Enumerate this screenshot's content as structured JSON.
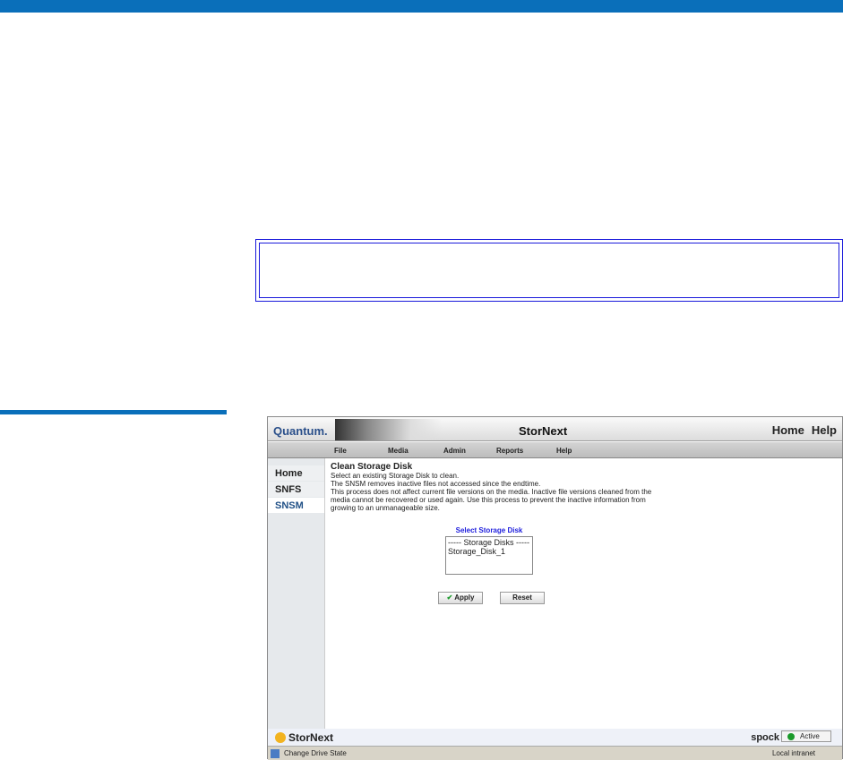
{
  "app": {
    "logo": "Quantum.",
    "title": "StorNext",
    "header_links": [
      "Home",
      "Help"
    ]
  },
  "menu": [
    "File",
    "Media",
    "Admin",
    "Reports",
    "Help"
  ],
  "sidebar": [
    "Home",
    "SNFS",
    "SNSM"
  ],
  "content": {
    "title": "Clean Storage Disk",
    "lines": [
      "Select an existing Storage Disk to clean.",
      "The SNSM removes inactive files not accessed since the endtime.",
      "This process does not affect current file versions on the media. Inactive file versions cleaned from the",
      "media cannot be recovered or used again. Use this process to prevent the inactive information from",
      "growing to an unmanageable size."
    ],
    "select_label": "Select Storage Disk",
    "options": [
      "----- Storage Disks -----",
      "Storage_Disk_1"
    ],
    "apply": "Apply",
    "reset": "Reset"
  },
  "footer": {
    "logo": "StorNext",
    "host": "spock",
    "status": "Active"
  },
  "statusbar": {
    "left": "Change Drive State",
    "right": "Local intranet"
  }
}
